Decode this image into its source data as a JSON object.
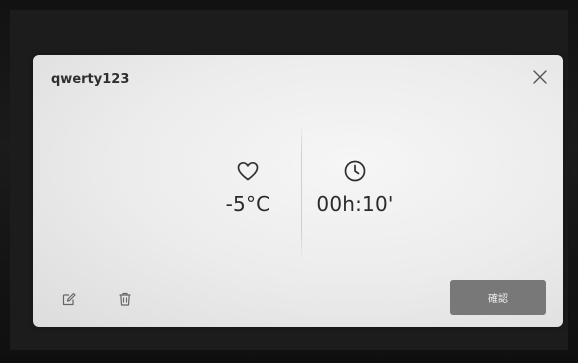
{
  "dialog": {
    "title": "qwerty123",
    "close_icon": "close-icon"
  },
  "stats": {
    "temperature": {
      "icon": "heart-icon",
      "value": "-5°C"
    },
    "duration": {
      "icon": "clock-icon",
      "value": "00h:10'"
    }
  },
  "toolbar": {
    "edit_icon": "edit-icon",
    "delete_icon": "trash-icon",
    "confirm_label": "確認"
  },
  "colors": {
    "dialog_bg": "#ececec",
    "confirm_bg": "#787878",
    "text_dark": "#2a2a2a"
  }
}
